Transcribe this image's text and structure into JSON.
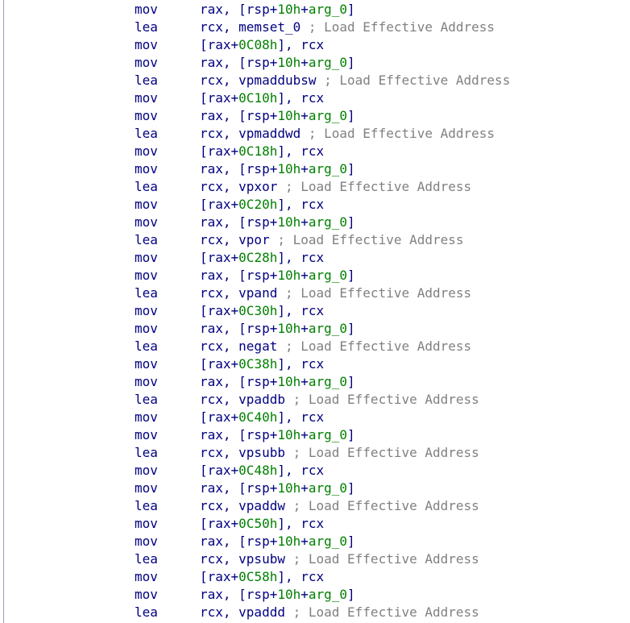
{
  "lines": [
    {
      "mn": "mov",
      "ops": [
        {
          "t": "rax, [rsp+",
          "c": "sym"
        },
        {
          "t": "10h",
          "c": "imm"
        },
        {
          "t": "+",
          "c": "sym"
        },
        {
          "t": "arg_0",
          "c": "var"
        },
        {
          "t": "]",
          "c": "sym"
        }
      ]
    },
    {
      "mn": "lea",
      "ops": [
        {
          "t": "rcx, memset_0",
          "c": "sym"
        },
        {
          "t": " ; Load Effective Address",
          "c": "comment"
        }
      ]
    },
    {
      "mn": "mov",
      "ops": [
        {
          "t": "[rax+",
          "c": "sym"
        },
        {
          "t": "0C08h",
          "c": "imm"
        },
        {
          "t": "], rcx",
          "c": "sym"
        }
      ]
    },
    {
      "mn": "mov",
      "ops": [
        {
          "t": "rax, [rsp+",
          "c": "sym"
        },
        {
          "t": "10h",
          "c": "imm"
        },
        {
          "t": "+",
          "c": "sym"
        },
        {
          "t": "arg_0",
          "c": "var"
        },
        {
          "t": "]",
          "c": "sym"
        }
      ]
    },
    {
      "mn": "lea",
      "ops": [
        {
          "t": "rcx, vpmaddubsw",
          "c": "sym"
        },
        {
          "t": " ; Load Effective Address",
          "c": "comment"
        }
      ]
    },
    {
      "mn": "mov",
      "ops": [
        {
          "t": "[rax+",
          "c": "sym"
        },
        {
          "t": "0C10h",
          "c": "imm"
        },
        {
          "t": "], rcx",
          "c": "sym"
        }
      ]
    },
    {
      "mn": "mov",
      "ops": [
        {
          "t": "rax, [rsp+",
          "c": "sym"
        },
        {
          "t": "10h",
          "c": "imm"
        },
        {
          "t": "+",
          "c": "sym"
        },
        {
          "t": "arg_0",
          "c": "var"
        },
        {
          "t": "]",
          "c": "sym"
        }
      ]
    },
    {
      "mn": "lea",
      "ops": [
        {
          "t": "rcx, vpmaddwd",
          "c": "sym"
        },
        {
          "t": " ; Load Effective Address",
          "c": "comment"
        }
      ]
    },
    {
      "mn": "mov",
      "ops": [
        {
          "t": "[rax+",
          "c": "sym"
        },
        {
          "t": "0C18h",
          "c": "imm"
        },
        {
          "t": "], rcx",
          "c": "sym"
        }
      ]
    },
    {
      "mn": "mov",
      "ops": [
        {
          "t": "rax, [rsp+",
          "c": "sym"
        },
        {
          "t": "10h",
          "c": "imm"
        },
        {
          "t": "+",
          "c": "sym"
        },
        {
          "t": "arg_0",
          "c": "var"
        },
        {
          "t": "]",
          "c": "sym"
        }
      ]
    },
    {
      "mn": "lea",
      "ops": [
        {
          "t": "rcx, vpxor",
          "c": "sym"
        },
        {
          "t": " ; Load Effective Address",
          "c": "comment"
        }
      ]
    },
    {
      "mn": "mov",
      "ops": [
        {
          "t": "[rax+",
          "c": "sym"
        },
        {
          "t": "0C20h",
          "c": "imm"
        },
        {
          "t": "], rcx",
          "c": "sym"
        }
      ]
    },
    {
      "mn": "mov",
      "ops": [
        {
          "t": "rax, [rsp+",
          "c": "sym"
        },
        {
          "t": "10h",
          "c": "imm"
        },
        {
          "t": "+",
          "c": "sym"
        },
        {
          "t": "arg_0",
          "c": "var"
        },
        {
          "t": "]",
          "c": "sym"
        }
      ]
    },
    {
      "mn": "lea",
      "ops": [
        {
          "t": "rcx, vpor",
          "c": "sym"
        },
        {
          "t": " ; Load Effective Address",
          "c": "comment"
        }
      ]
    },
    {
      "mn": "mov",
      "ops": [
        {
          "t": "[rax+",
          "c": "sym"
        },
        {
          "t": "0C28h",
          "c": "imm"
        },
        {
          "t": "], rcx",
          "c": "sym"
        }
      ]
    },
    {
      "mn": "mov",
      "ops": [
        {
          "t": "rax, [rsp+",
          "c": "sym"
        },
        {
          "t": "10h",
          "c": "imm"
        },
        {
          "t": "+",
          "c": "sym"
        },
        {
          "t": "arg_0",
          "c": "var"
        },
        {
          "t": "]",
          "c": "sym"
        }
      ]
    },
    {
      "mn": "lea",
      "ops": [
        {
          "t": "rcx, vpand",
          "c": "sym"
        },
        {
          "t": " ; Load Effective Address",
          "c": "comment"
        }
      ]
    },
    {
      "mn": "mov",
      "ops": [
        {
          "t": "[rax+",
          "c": "sym"
        },
        {
          "t": "0C30h",
          "c": "imm"
        },
        {
          "t": "], rcx",
          "c": "sym"
        }
      ]
    },
    {
      "mn": "mov",
      "ops": [
        {
          "t": "rax, [rsp+",
          "c": "sym"
        },
        {
          "t": "10h",
          "c": "imm"
        },
        {
          "t": "+",
          "c": "sym"
        },
        {
          "t": "arg_0",
          "c": "var"
        },
        {
          "t": "]",
          "c": "sym"
        }
      ]
    },
    {
      "mn": "lea",
      "ops": [
        {
          "t": "rcx, negat",
          "c": "sym"
        },
        {
          "t": " ; Load Effective Address",
          "c": "comment"
        }
      ]
    },
    {
      "mn": "mov",
      "ops": [
        {
          "t": "[rax+",
          "c": "sym"
        },
        {
          "t": "0C38h",
          "c": "imm"
        },
        {
          "t": "], rcx",
          "c": "sym"
        }
      ]
    },
    {
      "mn": "mov",
      "ops": [
        {
          "t": "rax, [rsp+",
          "c": "sym"
        },
        {
          "t": "10h",
          "c": "imm"
        },
        {
          "t": "+",
          "c": "sym"
        },
        {
          "t": "arg_0",
          "c": "var"
        },
        {
          "t": "]",
          "c": "sym"
        }
      ]
    },
    {
      "mn": "lea",
      "ops": [
        {
          "t": "rcx, vpaddb",
          "c": "sym"
        },
        {
          "t": " ; Load Effective Address",
          "c": "comment"
        }
      ]
    },
    {
      "mn": "mov",
      "ops": [
        {
          "t": "[rax+",
          "c": "sym"
        },
        {
          "t": "0C40h",
          "c": "imm"
        },
        {
          "t": "], rcx",
          "c": "sym"
        }
      ]
    },
    {
      "mn": "mov",
      "ops": [
        {
          "t": "rax, [rsp+",
          "c": "sym"
        },
        {
          "t": "10h",
          "c": "imm"
        },
        {
          "t": "+",
          "c": "sym"
        },
        {
          "t": "arg_0",
          "c": "var"
        },
        {
          "t": "]",
          "c": "sym"
        }
      ]
    },
    {
      "mn": "lea",
      "ops": [
        {
          "t": "rcx, vpsubb",
          "c": "sym"
        },
        {
          "t": " ; Load Effective Address",
          "c": "comment"
        }
      ]
    },
    {
      "mn": "mov",
      "ops": [
        {
          "t": "[rax+",
          "c": "sym"
        },
        {
          "t": "0C48h",
          "c": "imm"
        },
        {
          "t": "], rcx",
          "c": "sym"
        }
      ]
    },
    {
      "mn": "mov",
      "ops": [
        {
          "t": "rax, [rsp+",
          "c": "sym"
        },
        {
          "t": "10h",
          "c": "imm"
        },
        {
          "t": "+",
          "c": "sym"
        },
        {
          "t": "arg_0",
          "c": "var"
        },
        {
          "t": "]",
          "c": "sym"
        }
      ]
    },
    {
      "mn": "lea",
      "ops": [
        {
          "t": "rcx, vpaddw",
          "c": "sym"
        },
        {
          "t": " ; Load Effective Address",
          "c": "comment"
        }
      ]
    },
    {
      "mn": "mov",
      "ops": [
        {
          "t": "[rax+",
          "c": "sym"
        },
        {
          "t": "0C50h",
          "c": "imm"
        },
        {
          "t": "], rcx",
          "c": "sym"
        }
      ]
    },
    {
      "mn": "mov",
      "ops": [
        {
          "t": "rax, [rsp+",
          "c": "sym"
        },
        {
          "t": "10h",
          "c": "imm"
        },
        {
          "t": "+",
          "c": "sym"
        },
        {
          "t": "arg_0",
          "c": "var"
        },
        {
          "t": "]",
          "c": "sym"
        }
      ]
    },
    {
      "mn": "lea",
      "ops": [
        {
          "t": "rcx, vpsubw",
          "c": "sym"
        },
        {
          "t": " ; Load Effective Address",
          "c": "comment"
        }
      ]
    },
    {
      "mn": "mov",
      "ops": [
        {
          "t": "[rax+",
          "c": "sym"
        },
        {
          "t": "0C58h",
          "c": "imm"
        },
        {
          "t": "], rcx",
          "c": "sym"
        }
      ]
    },
    {
      "mn": "mov",
      "ops": [
        {
          "t": "rax, [rsp+",
          "c": "sym"
        },
        {
          "t": "10h",
          "c": "imm"
        },
        {
          "t": "+",
          "c": "sym"
        },
        {
          "t": "arg_0",
          "c": "var"
        },
        {
          "t": "]",
          "c": "sym"
        }
      ]
    },
    {
      "mn": "lea",
      "ops": [
        {
          "t": "rcx, vpaddd",
          "c": "sym"
        },
        {
          "t": " ; Load Effective Address",
          "c": "comment"
        }
      ]
    }
  ],
  "colors": {
    "mnemonic": "#000080",
    "operand": "#000080",
    "immediate": "#008000",
    "variable": "#008000",
    "comment": "#808080",
    "background": "#ffffff"
  }
}
